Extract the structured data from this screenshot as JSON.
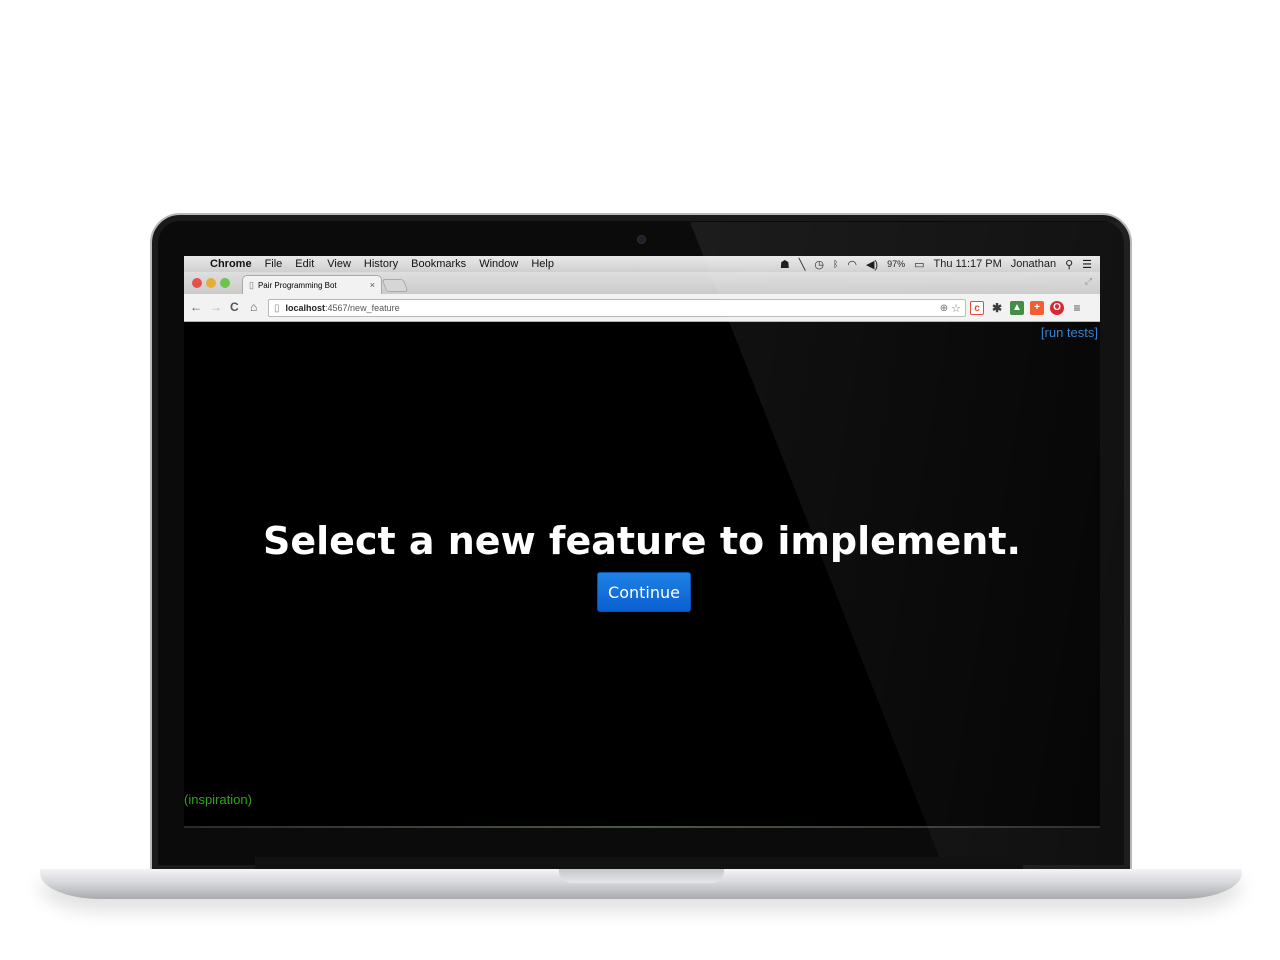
{
  "menubar": {
    "apple": "",
    "app_name": "Chrome",
    "items": [
      "File",
      "Edit",
      "View",
      "History",
      "Bookmarks",
      "Window",
      "Help"
    ],
    "battery": "97%",
    "clock": "Thu 11:17 PM",
    "user": "Jonathan"
  },
  "browser": {
    "tab_title": "Pair Programming Bot",
    "tab_close": "×",
    "url_host": "localhost",
    "url_path": ":4567/new_feature"
  },
  "page": {
    "run_tests": "[run tests]",
    "heading": "Select a new feature to implement.",
    "continue_label": "Continue",
    "inspiration": "(inspiration)"
  },
  "colors": {
    "link": "#2d7fd1",
    "button": "#0a6ad8",
    "inspiration": "#2fa51a",
    "background": "#000000"
  }
}
